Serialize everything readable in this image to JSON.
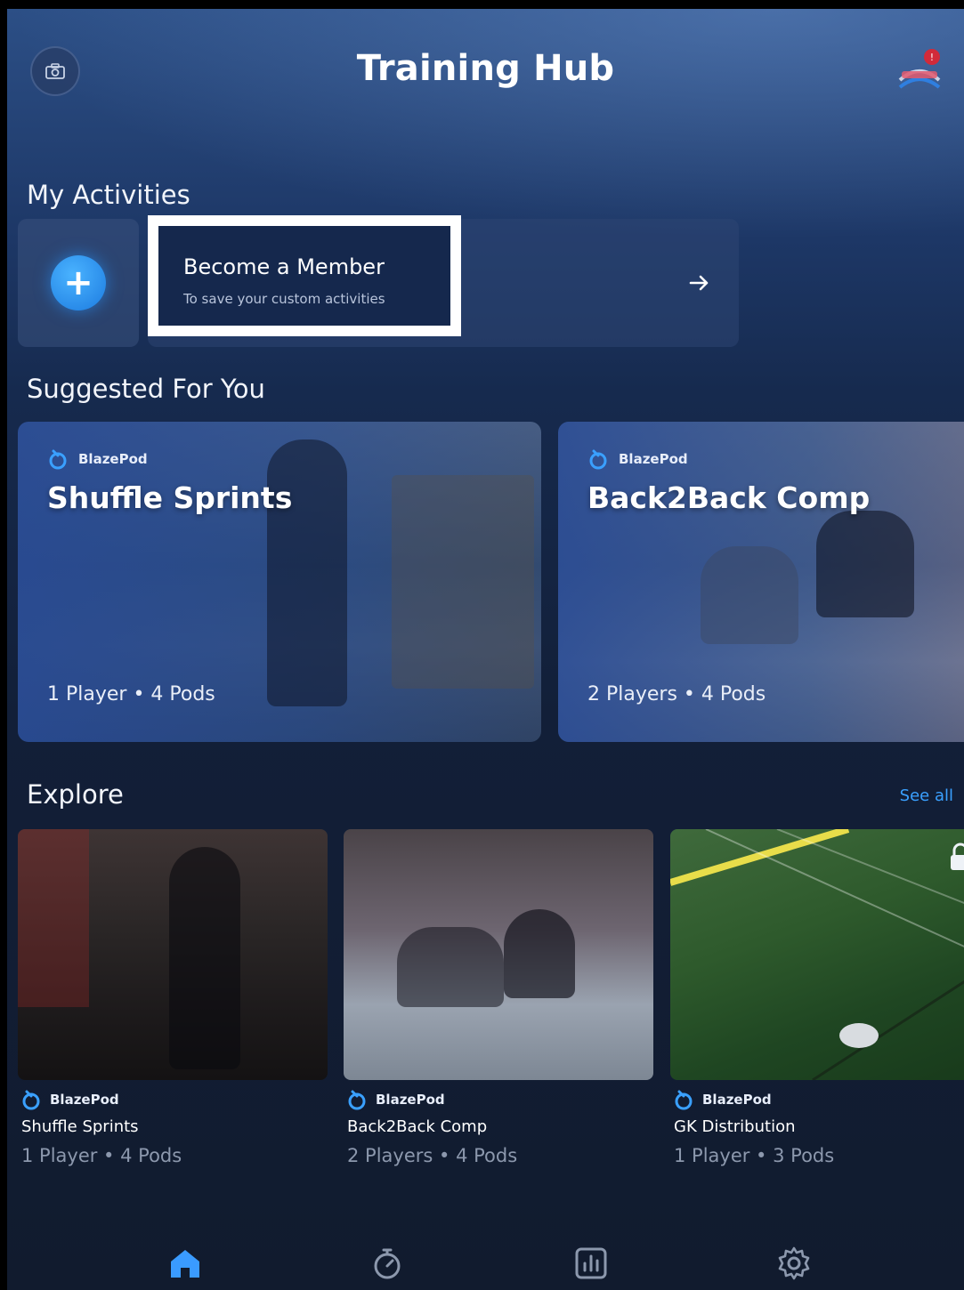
{
  "header": {
    "title": "Training Hub"
  },
  "my_activities": {
    "title": "My Activities",
    "member_card": {
      "title": "Become a Member",
      "subtitle": "To save your custom activities"
    }
  },
  "suggested": {
    "title": "Suggested For You",
    "cards": [
      {
        "brand": "BlazePod",
        "title": "Shuffle Sprints",
        "meta": "1 Player • 4 Pods"
      },
      {
        "brand": "BlazePod",
        "title": "Back2Back Comp",
        "meta": "2 Players • 4 Pods"
      }
    ]
  },
  "explore": {
    "title": "Explore",
    "see_all": "See all",
    "items": [
      {
        "brand": "BlazePod",
        "title": "Shuffle Sprints",
        "meta": "1 Player • 4 Pods",
        "locked": false
      },
      {
        "brand": "BlazePod",
        "title": "Back2Back Comp",
        "meta": "2 Players • 4 Pods",
        "locked": false
      },
      {
        "brand": "BlazePod",
        "title": "GK Distribution",
        "meta": "1 Player • 3 Pods",
        "locked": true
      }
    ]
  },
  "tabbar": {
    "items": [
      "home-icon",
      "stopwatch-icon",
      "stats-icon",
      "gear-icon"
    ],
    "active": "home-icon"
  },
  "colors": {
    "accent": "#3aa0ff",
    "background": "#121f38",
    "highlight_border": "#ffffff"
  }
}
